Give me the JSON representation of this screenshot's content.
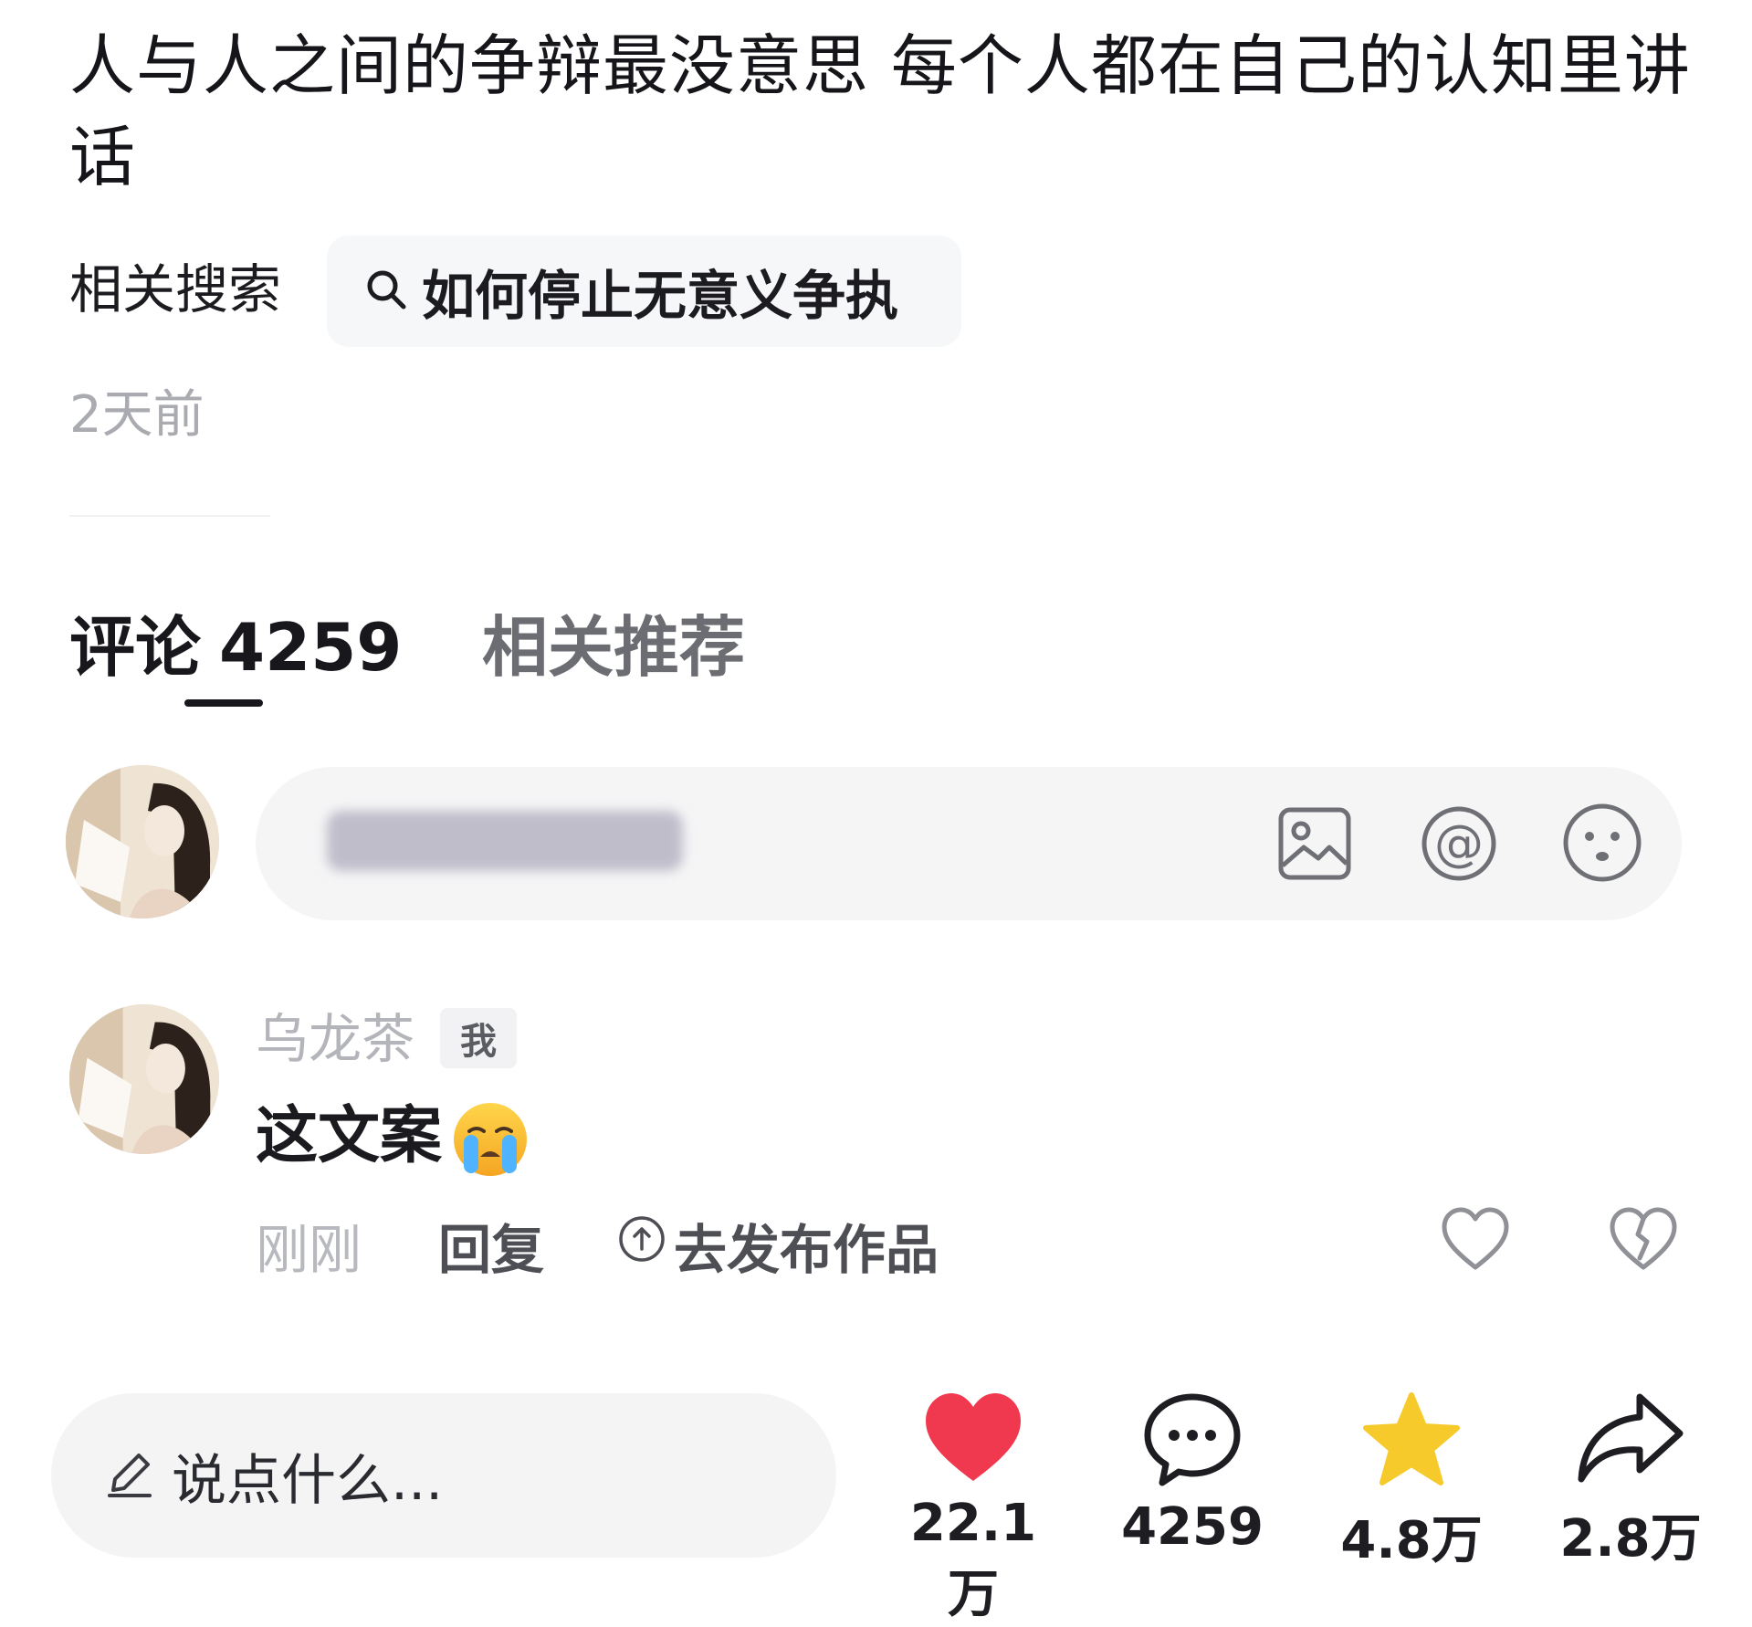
{
  "post": {
    "title": "人与人之间的争辩最没意思 每个人都在自己的认知里讲话",
    "related_label": "相关搜索",
    "related_query": "如何停止无意义争执",
    "time_ago": "2天前"
  },
  "tabs": {
    "comments_label": "评论",
    "comments_count": "4259",
    "related_label": "相关推荐"
  },
  "comment_input": {
    "icons": [
      "image-icon",
      "at-icon",
      "emoji-icon"
    ]
  },
  "comment": {
    "username": "乌龙茶",
    "badge": "我",
    "text": "这文案",
    "emoji": "loudly-crying-face",
    "time": "刚刚",
    "reply_label": "回复",
    "publish_label": "去发布作品"
  },
  "bottom_bar": {
    "input_placeholder": "说点什么...",
    "likes": "22.1万",
    "comments": "4259",
    "favorites": "4.8万",
    "shares": "2.8万"
  },
  "colors": {
    "like_red": "#f0394f",
    "star_yellow": "#f7ca2b",
    "muted_gray": "#b3b5ba"
  }
}
